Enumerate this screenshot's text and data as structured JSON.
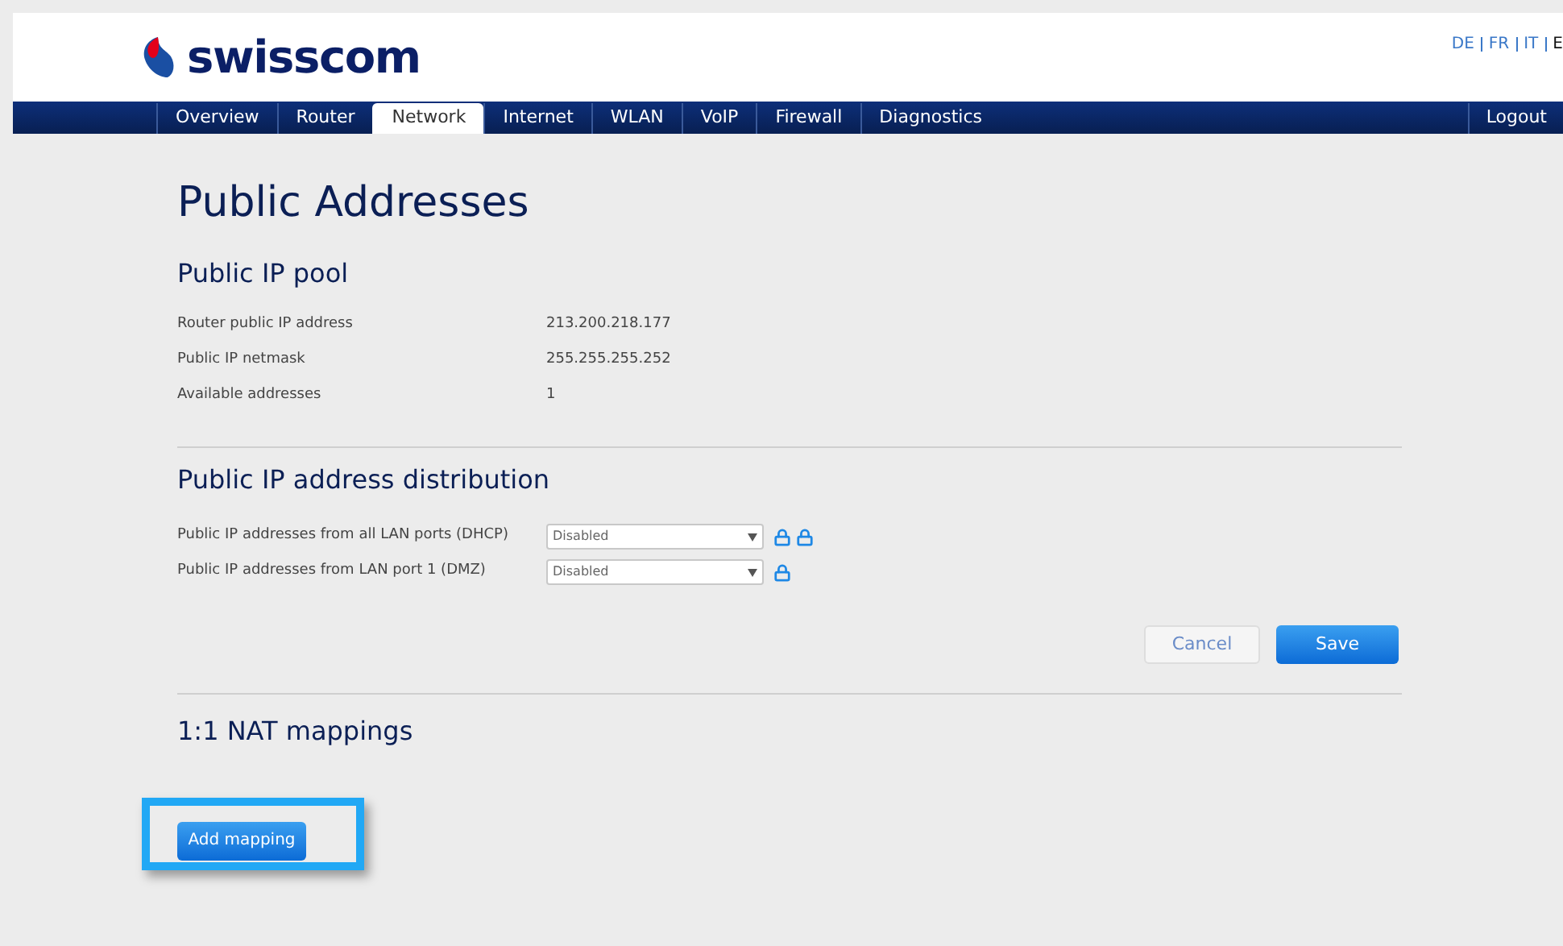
{
  "logo": {
    "text": "swisscom"
  },
  "languages": [
    "DE",
    "FR",
    "IT",
    "E"
  ],
  "tabs": [
    {
      "label": "Overview",
      "selected": false
    },
    {
      "label": "Router",
      "selected": false
    },
    {
      "label": "Network",
      "selected": true
    },
    {
      "label": "Internet",
      "selected": false
    },
    {
      "label": "WLAN",
      "selected": false
    },
    {
      "label": "VoIP",
      "selected": false
    },
    {
      "label": "Firewall",
      "selected": false
    },
    {
      "label": "Diagnostics",
      "selected": false
    }
  ],
  "logout": "Logout",
  "page_title": "Public Addresses",
  "pool": {
    "heading": "Public IP pool",
    "rows": [
      {
        "label": "Router public IP address",
        "value": "213.200.218.177"
      },
      {
        "label": "Public IP netmask",
        "value": "255.255.255.252"
      },
      {
        "label": "Available addresses",
        "value": "1"
      }
    ]
  },
  "distribution": {
    "heading": "Public IP address distribution",
    "rows": [
      {
        "label": "Public IP addresses from all LAN ports (DHCP)",
        "value": "Disabled",
        "locks": [
          {
            "kind": "lock"
          },
          {
            "kind": "lock"
          }
        ]
      },
      {
        "label": "Public IP addresses from LAN port 1 (DMZ)",
        "value": "Disabled",
        "locks": [
          {
            "kind": "lock"
          }
        ]
      }
    ]
  },
  "buttons": {
    "cancel": "Cancel",
    "save": "Save"
  },
  "nat": {
    "heading": "1:1 NAT mappings",
    "add_button": "Add mapping",
    "highlighted": true
  }
}
